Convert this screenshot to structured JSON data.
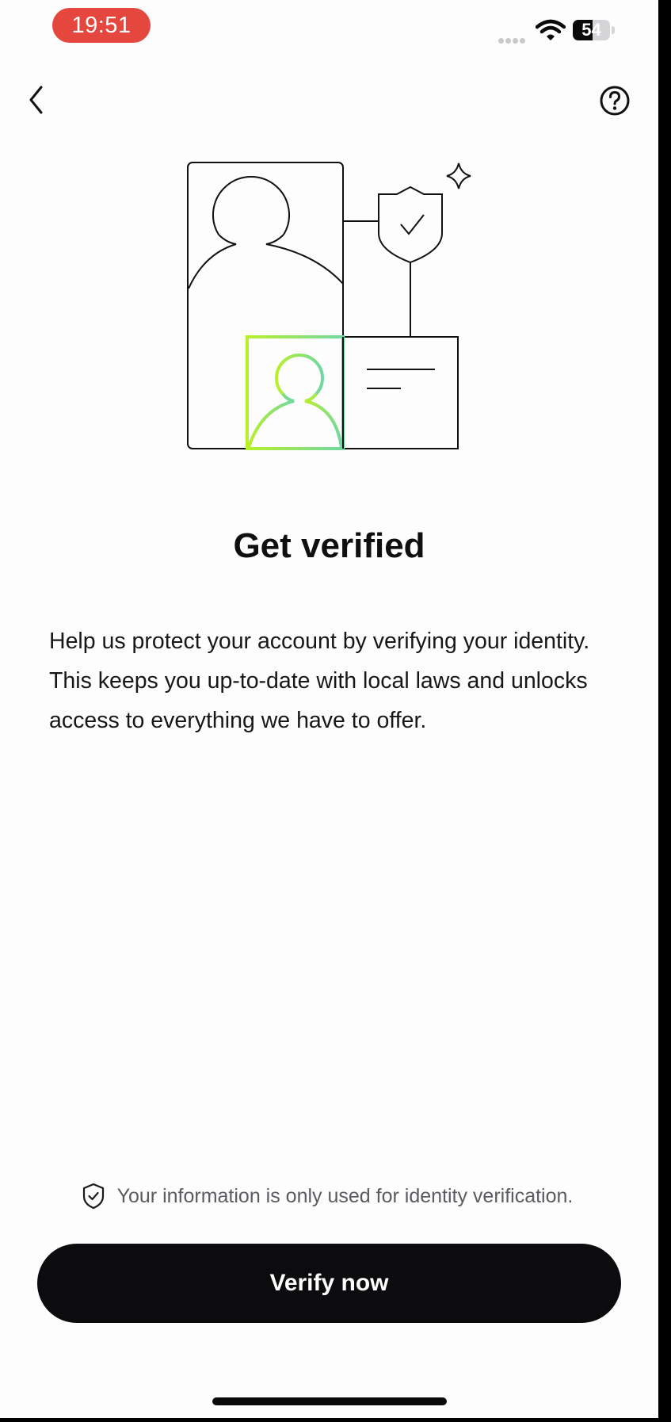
{
  "status_bar": {
    "time": "19:51",
    "battery_level": "54",
    "battery_fraction": 0.54,
    "time_pill_color": "#e5473f"
  },
  "nav": {
    "back_icon": "chevron-left-icon",
    "help_icon": "question-circle-icon"
  },
  "hero": {
    "illustration": "identity-verification-illustration"
  },
  "content": {
    "title": "Get verified",
    "description": "Help us protect your account by verifying your identity. This keeps you up-to-date with local laws and unlocks access to everything we have to offer."
  },
  "footer": {
    "privacy_icon": "shield-check-icon",
    "privacy_note": "Your information is only used for identity verification.",
    "verify_label": "Verify now"
  },
  "colors": {
    "background": "#fdfdfe",
    "primary_button": "#0c0c0e",
    "accent_gradient_start": "#b8f02a",
    "accent_gradient_end": "#6fd8a2"
  }
}
